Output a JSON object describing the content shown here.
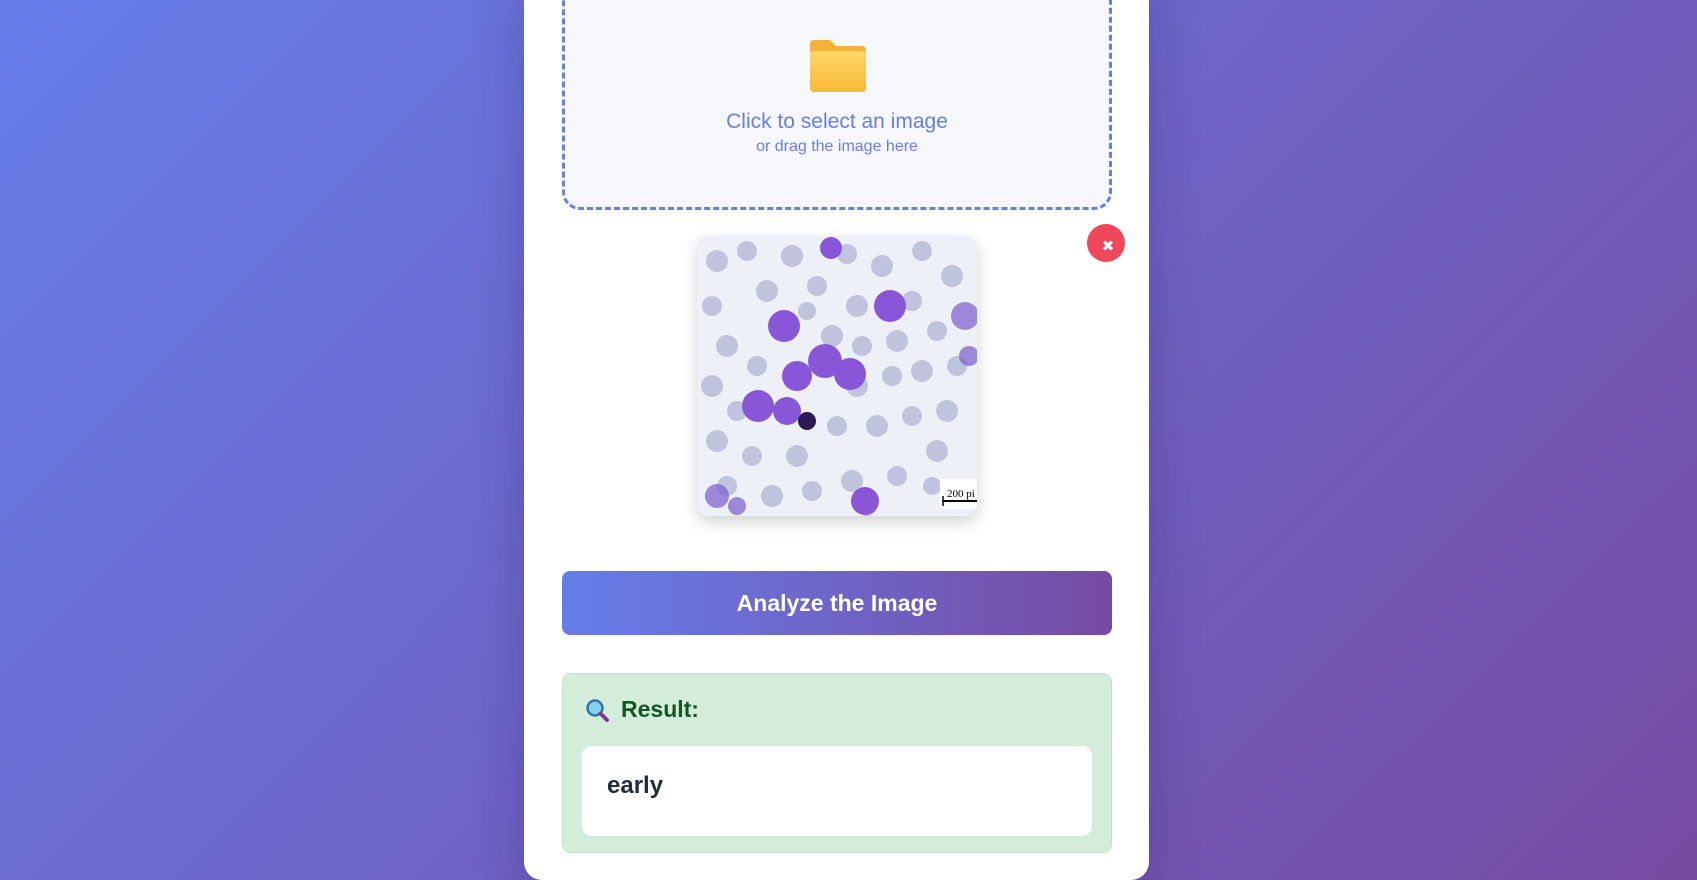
{
  "upload": {
    "icon": "folder-icon",
    "main_text": "Click to select an image",
    "sub_text": "or drag the image here"
  },
  "preview": {
    "scale_label": "200 pi",
    "remove_icon": "close-icon",
    "remove_symbol": "✖"
  },
  "analyze_button": {
    "label": "Analyze the Image"
  },
  "result": {
    "icon": "magnifier-icon",
    "title": "Result:",
    "value": "early"
  },
  "colors": {
    "background_start": "#667eea",
    "background_end": "#764ba2",
    "accent": "#667eea",
    "remove": "#f0475c",
    "result_bg": "#d4edda",
    "result_text": "#155724"
  }
}
